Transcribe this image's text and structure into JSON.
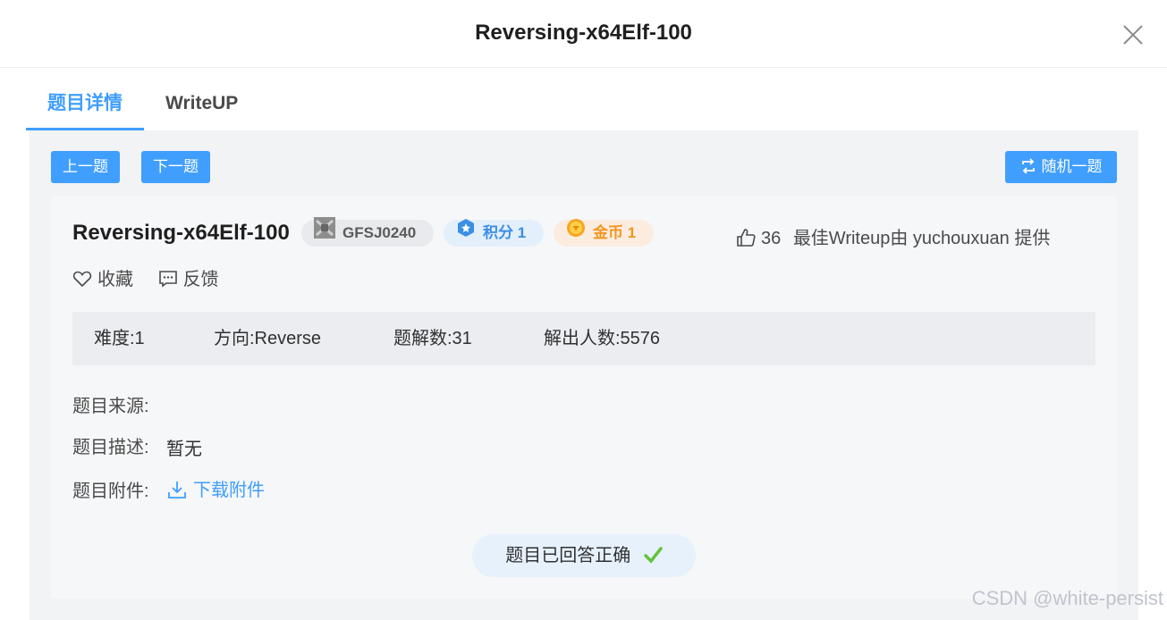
{
  "dialog": {
    "title": "Reversing-x64Elf-100"
  },
  "tabs": [
    {
      "label": "题目详情",
      "active": true
    },
    {
      "label": "WriteUP",
      "active": false
    }
  ],
  "nav": {
    "prev": "上一题",
    "next": "下一题",
    "random": "随机一题"
  },
  "challenge": {
    "title": "Reversing-x64Elf-100",
    "id_tag": "GFSJ0240",
    "score_tag": "积分 1",
    "gold_tag": "金币 1",
    "likes": "36",
    "best_writeup": "最佳Writeup由 yuchouxuan 提供",
    "favorite": "收藏",
    "feedback": "反馈"
  },
  "stats": {
    "difficulty": "难度:1",
    "direction": "方向:Reverse",
    "solutions": "题解数:31",
    "solvers": "解出人数:5576"
  },
  "fields": {
    "source_label": "题目来源:",
    "desc_label": "题目描述:",
    "desc_value": "暂无",
    "attach_label": "题目附件:",
    "attach_link": "下载附件"
  },
  "status": {
    "solved": "题目已回答正确"
  },
  "watermark": "CSDN @white-persist",
  "colors": {
    "accent": "#409eff",
    "gold": "#f0961f",
    "success": "#67c23a"
  }
}
